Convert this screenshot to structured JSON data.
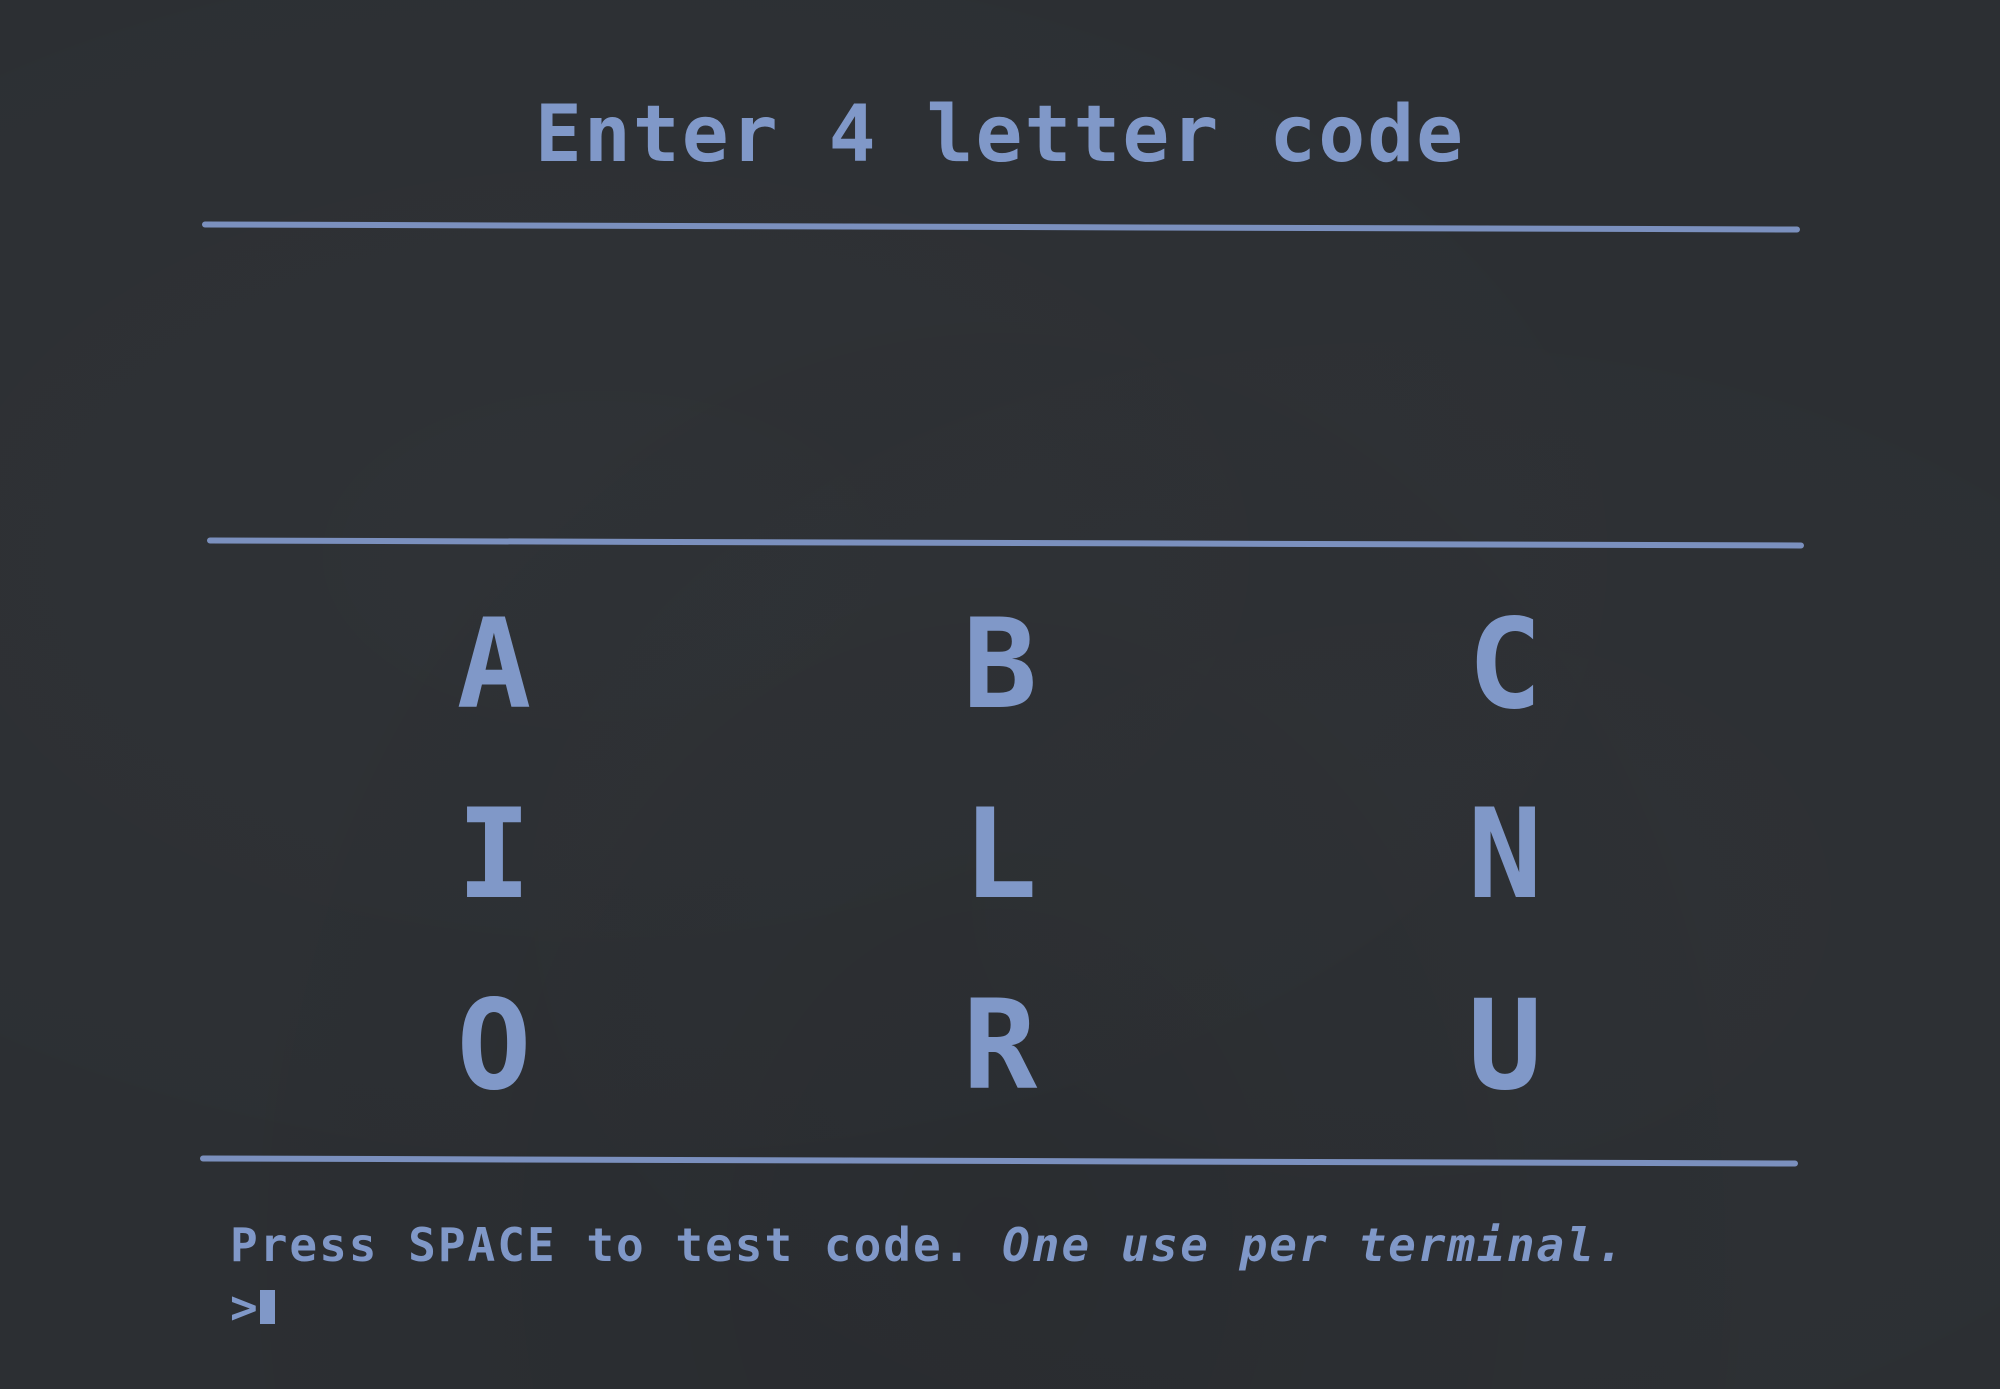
{
  "title": "Enter 4 letter code",
  "code_entry": {
    "value": ""
  },
  "keypad": {
    "keys": [
      {
        "letter": "A"
      },
      {
        "letter": "B"
      },
      {
        "letter": "C"
      },
      {
        "letter": "I"
      },
      {
        "letter": "L"
      },
      {
        "letter": "N"
      },
      {
        "letter": "O"
      },
      {
        "letter": "R"
      },
      {
        "letter": "U"
      }
    ]
  },
  "footer": {
    "instruction": "Press SPACE to test code.",
    "note": "One use per terminal.",
    "prompt_symbol": ">"
  },
  "colors": {
    "background": "#2c2f33",
    "text": "#8098c8"
  }
}
